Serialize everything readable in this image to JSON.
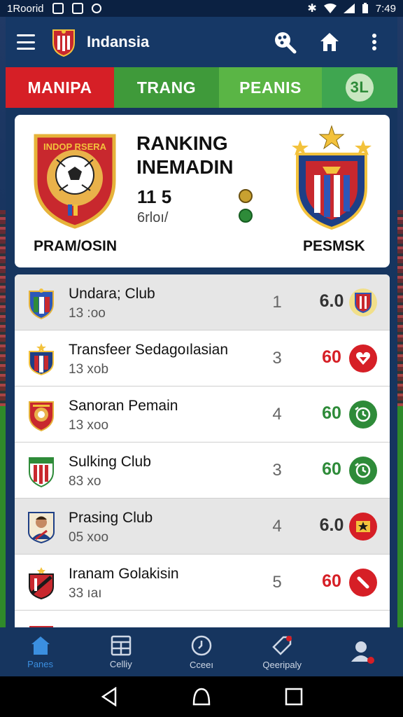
{
  "status_bar": {
    "left_text": "1Roorid",
    "time": "7:49"
  },
  "app_bar": {
    "title": "Indansia"
  },
  "tabs": [
    {
      "label": "MANIPA",
      "color": "#d61f26"
    },
    {
      "label": "TRANG",
      "color": "#3f9a3a"
    },
    {
      "label": "PEANIS",
      "color": "#5ab545"
    },
    {
      "label": "3L",
      "color": "#3fa650"
    }
  ],
  "match": {
    "title": "RANKING INEMADIN",
    "score": "11 5",
    "sub": "6rloı/",
    "home_team": "PRAM/OSIN",
    "home_crest_text": "INDOP RSERA",
    "away_team": "PESMSK"
  },
  "rows": [
    {
      "name": "Undara; Club",
      "sub": "13 :oo",
      "rank": "1",
      "score": "6.0",
      "score_color": "#333333",
      "badge_color": "#f1df8a",
      "badge_icon": "flag-icon",
      "shade": true
    },
    {
      "name": "Transfeer Sedagoılasian",
      "sub": "13 xob",
      "rank": "3",
      "score": "60",
      "score_color": "#d61f26",
      "badge_color": "#d61f26",
      "badge_icon": "heart-icon",
      "shade": false
    },
    {
      "name": "Sanoran Pemain",
      "sub": "13 xoo",
      "rank": "4",
      "score": "60",
      "score_color": "#2e8b39",
      "badge_color": "#2e8b39",
      "badge_icon": "clock-icon",
      "shade": false
    },
    {
      "name": "Sulking Club",
      "sub": "83 xo",
      "rank": "3",
      "score": "60",
      "score_color": "#2e8b39",
      "badge_color": "#2e8b39",
      "badge_icon": "clock-icon",
      "shade": false
    },
    {
      "name": "Prasing Club",
      "sub": "05 xoo",
      "rank": "4",
      "score": "6.0",
      "score_color": "#333333",
      "badge_color": "#d61f26",
      "badge_icon": "star-icon",
      "shade": true
    },
    {
      "name": "Iranam Golakisin",
      "sub": "33 ıaı",
      "rank": "5",
      "score": "60",
      "score_color": "#d61f26",
      "badge_color": "#d61f26",
      "badge_icon": "slash-icon",
      "shade": false
    }
  ],
  "bottom_nav": [
    {
      "label": "Panes",
      "icon": "home-icon",
      "active": true
    },
    {
      "label": "Celliy",
      "icon": "grid-icon",
      "active": false
    },
    {
      "label": "Cceeı",
      "icon": "clock-icon",
      "active": false
    },
    {
      "label": "Qeeripaly",
      "icon": "tag-icon",
      "active": false
    },
    {
      "label": "",
      "icon": "profile-icon",
      "active": false
    }
  ]
}
